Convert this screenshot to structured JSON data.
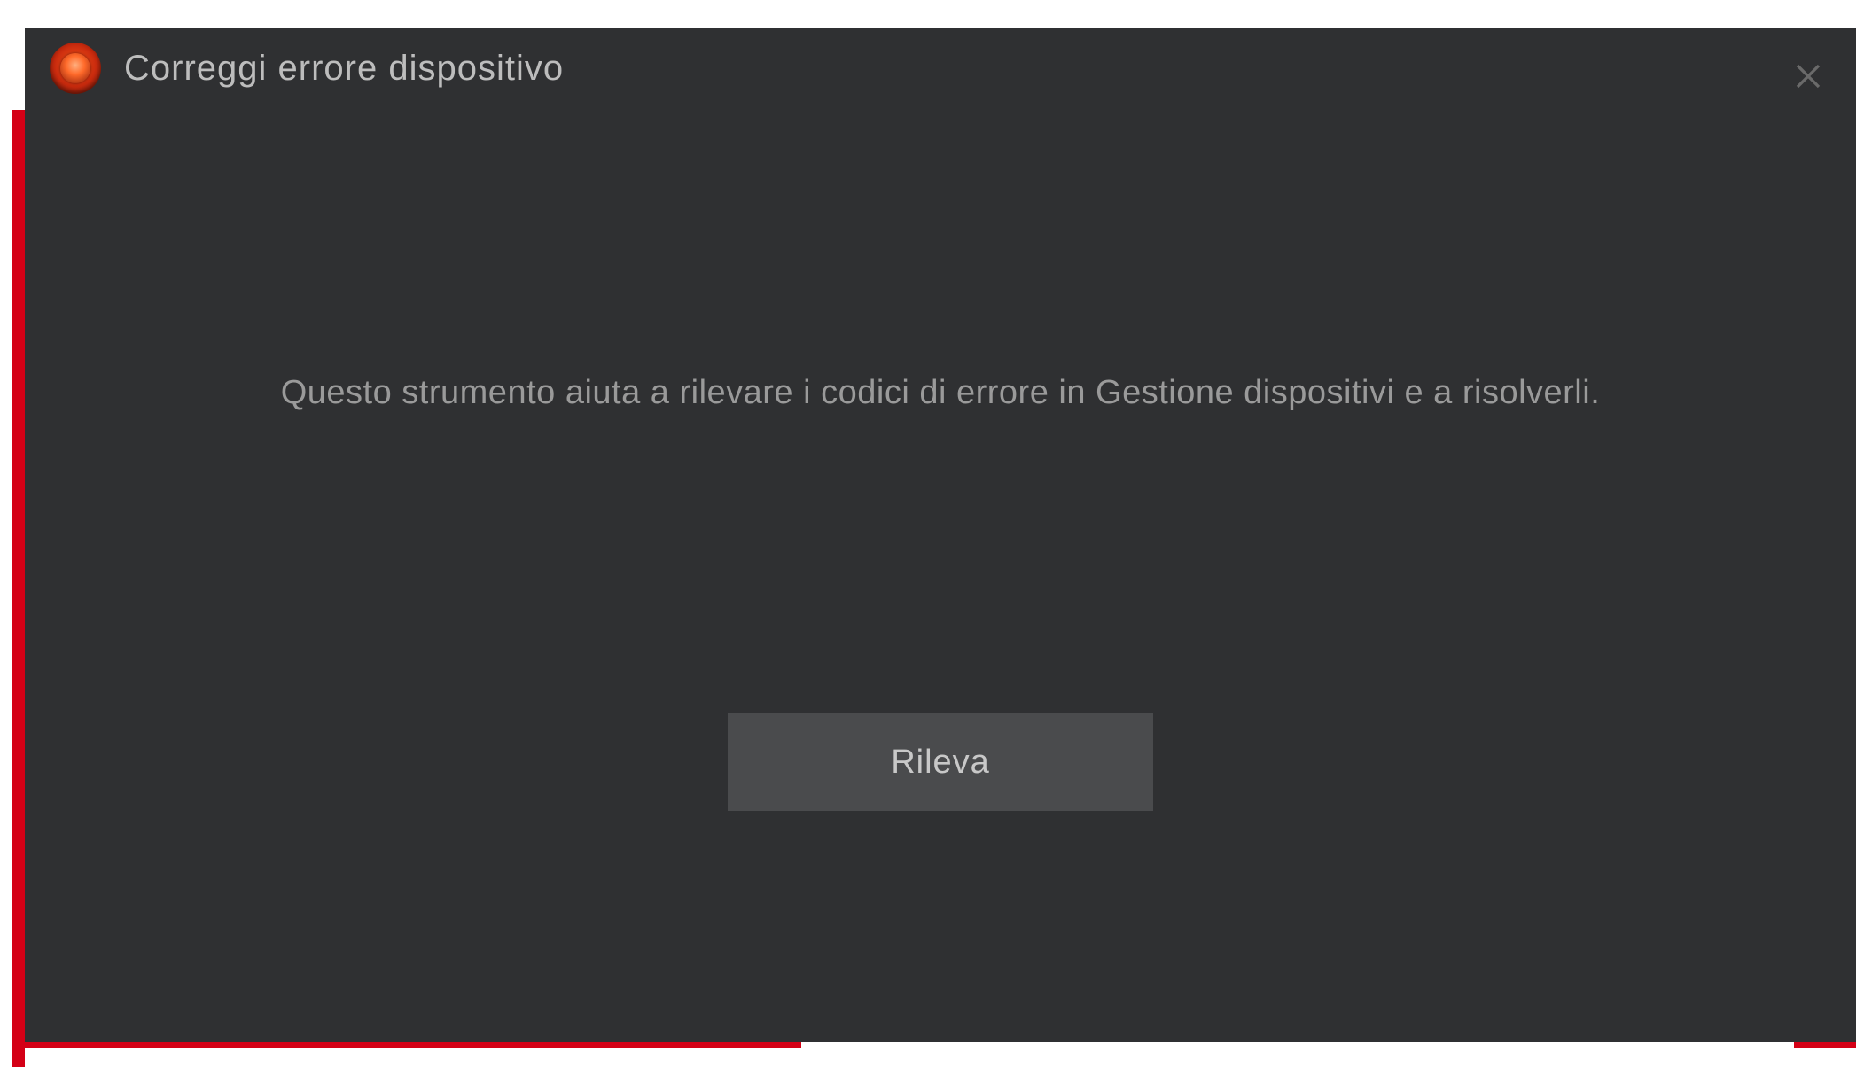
{
  "dialog": {
    "title": "Correggi errore dispositivo",
    "description": "Questo strumento aiuta a rilevare i codici di errore in Gestione dispositivi e a risolverli.",
    "detect_button_label": "Rileva",
    "icon_name": "app-icon",
    "close_icon_name": "close-icon"
  },
  "colors": {
    "dialog_bg": "#2f3032",
    "accent_red": "#d40016",
    "button_bg": "#4a4b4d",
    "title_text": "#bdbdbd",
    "desc_text": "#9a9a9a"
  }
}
